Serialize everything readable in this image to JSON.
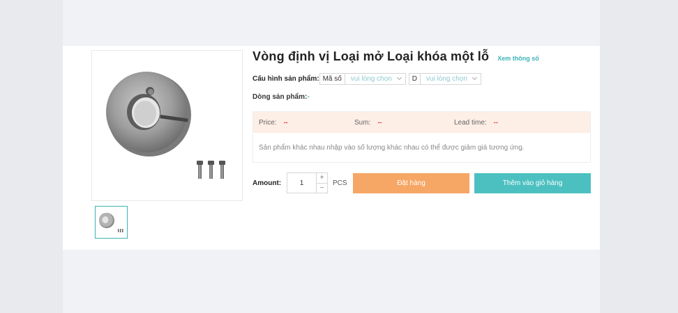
{
  "product": {
    "title": "Vòng định vị Loại mở Loại khóa một lỗ",
    "spec_link": "Xem thông số",
    "config_label": "Cấu hình sản phẩm:",
    "fields": [
      {
        "name": "Mã số",
        "placeholder": "vui lòng chọn"
      },
      {
        "name": "D",
        "placeholder": "vui lòng chọn"
      }
    ],
    "line_label": "Dòng sản phẩm:",
    "line_value": "-"
  },
  "pricing": {
    "price_label": "Price:",
    "price_value": "--",
    "sum_label": "Sum:",
    "sum_value": "--",
    "lead_label": "Lead time:",
    "lead_value": "--",
    "note": "Sản phẩm khác nhau nhập vào số lượng khác nhau có thể được giảm giá tương ứng."
  },
  "purchase": {
    "amount_label": "Amount:",
    "quantity": "1",
    "plus": "+",
    "minus": "−",
    "unit": "PCS",
    "order_label": "Đặt hàng",
    "cart_label": "Thêm vào giỏ hàng"
  },
  "colors": {
    "accent": "#3bb3b8",
    "order_button": "#f6a665",
    "cart_button": "#4cc0c0",
    "price_header_bg": "#fdeee6",
    "dash_red": "#e1342c"
  }
}
